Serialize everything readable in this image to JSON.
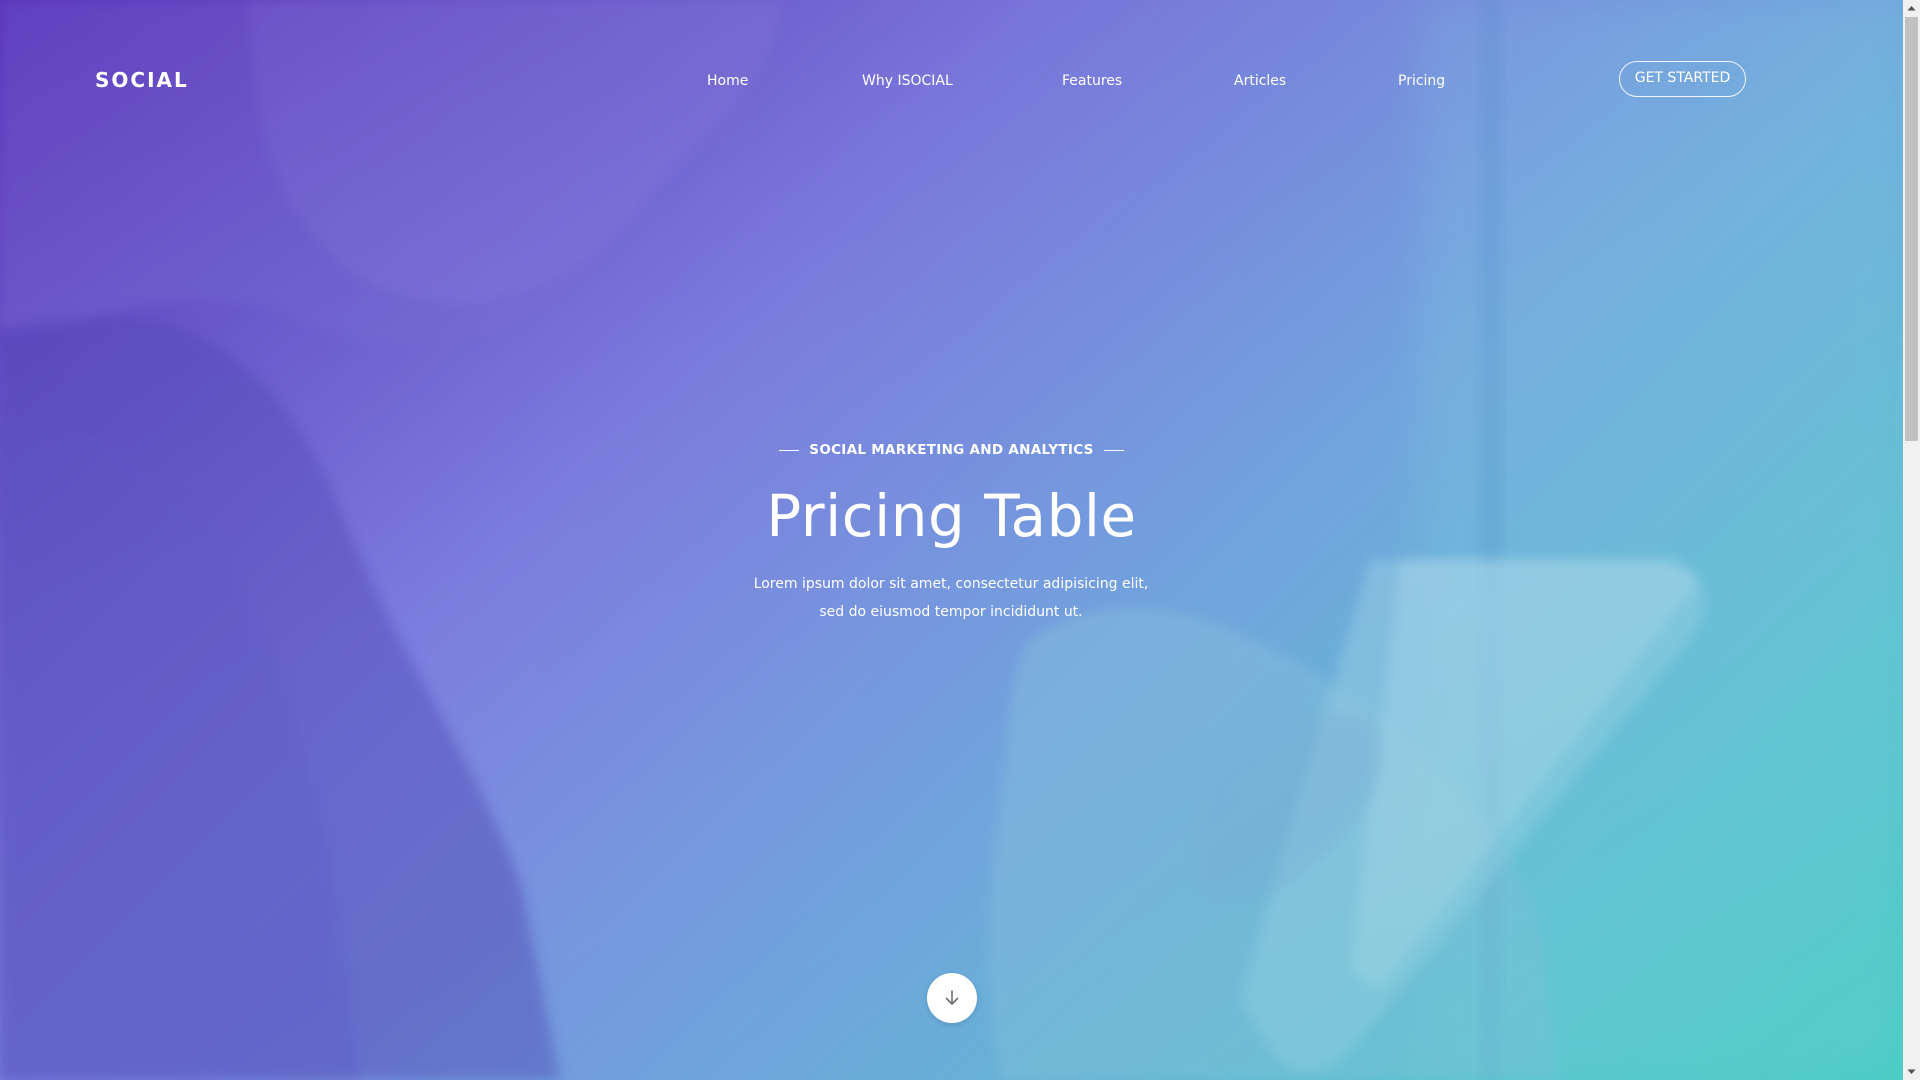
{
  "header": {
    "logo": "SOCIAL",
    "nav": [
      {
        "label": "Home"
      },
      {
        "label": "Why ISOCIAL"
      },
      {
        "label": "Features"
      },
      {
        "label": "Articles"
      },
      {
        "label": "Pricing"
      }
    ],
    "cta_label": "GET STARTED"
  },
  "hero": {
    "eyebrow": "SOCIAL MARKETING AND ANALYTICS",
    "title": "Pricing Table",
    "subtitle": "Lorem ipsum dolor sit amet, consectetur adipisicing elit, sed do eiusmod tempor incididunt ut."
  },
  "icons": {
    "scroll_down": "arrow-down-icon"
  },
  "colors": {
    "gradient_start": "#5533b9",
    "gradient_mid": "#7f7fe0",
    "gradient_end": "#4fcfc6",
    "text": "#ffffff",
    "button_bg": "#ffffff"
  }
}
